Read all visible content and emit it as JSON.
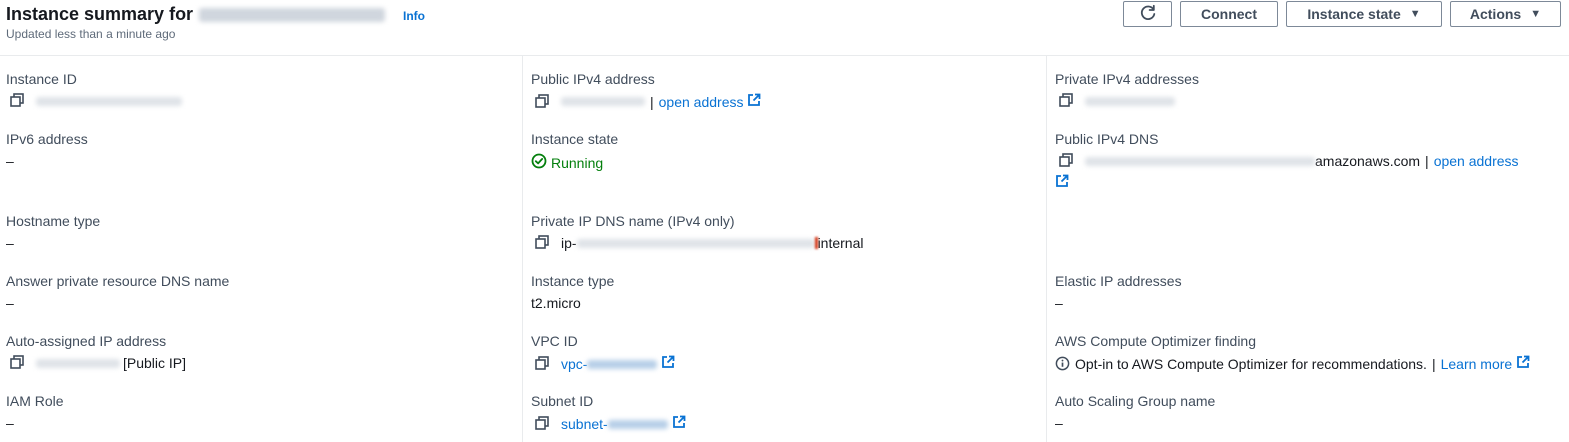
{
  "header": {
    "title": "Instance summary for",
    "info": "Info",
    "subtitle": "Updated less than a minute ago",
    "buttons": {
      "connect": "Connect",
      "instance_state": "Instance state",
      "actions": "Actions"
    }
  },
  "details": {
    "instance_id": {
      "label": "Instance ID"
    },
    "ipv6": {
      "label": "IPv6 address",
      "value": "–"
    },
    "hostname_type": {
      "label": "Hostname type",
      "value": "–"
    },
    "answer_dns": {
      "label": "Answer private resource DNS name",
      "value": "–"
    },
    "auto_ip": {
      "label": "Auto-assigned IP address",
      "suffix": "[Public IP]"
    },
    "iam_role": {
      "label": "IAM Role",
      "value": "–"
    },
    "public_ipv4": {
      "label": "Public IPv4 address",
      "link": "open address",
      "sep": "|"
    },
    "instance_state": {
      "label": "Instance state",
      "value": "Running"
    },
    "private_dns": {
      "label": "Private IP DNS name (IPv4 only)",
      "prefix": "ip-",
      "suffix": "internal"
    },
    "instance_type": {
      "label": "Instance type",
      "value": "t2.micro"
    },
    "vpc_id": {
      "label": "VPC ID",
      "prefix": "vpc-"
    },
    "subnet_id": {
      "label": "Subnet ID",
      "prefix": "subnet-"
    },
    "private_ipv4": {
      "label": "Private IPv4 addresses"
    },
    "public_dns": {
      "label": "Public IPv4 DNS",
      "suffix": "amazonaws.com",
      "sep": "|",
      "link": "open address"
    },
    "elastic_ip": {
      "label": "Elastic IP addresses",
      "value": "–"
    },
    "optimizer": {
      "label": "AWS Compute Optimizer finding",
      "text": "Opt-in to AWS Compute Optimizer for recommendations.",
      "sep": "|",
      "link": "Learn more"
    },
    "asg_name": {
      "label": "Auto Scaling Group name",
      "value": "–"
    }
  },
  "colors": {
    "link": "#0972d3",
    "success": "#037f0c",
    "label": "#414d5c",
    "text": "#16191f"
  },
  "icons": {
    "copy": "copy-icon",
    "external": "external-link-icon",
    "refresh": "refresh-icon",
    "status": "check-circle-icon",
    "info": "info-circle-icon"
  }
}
